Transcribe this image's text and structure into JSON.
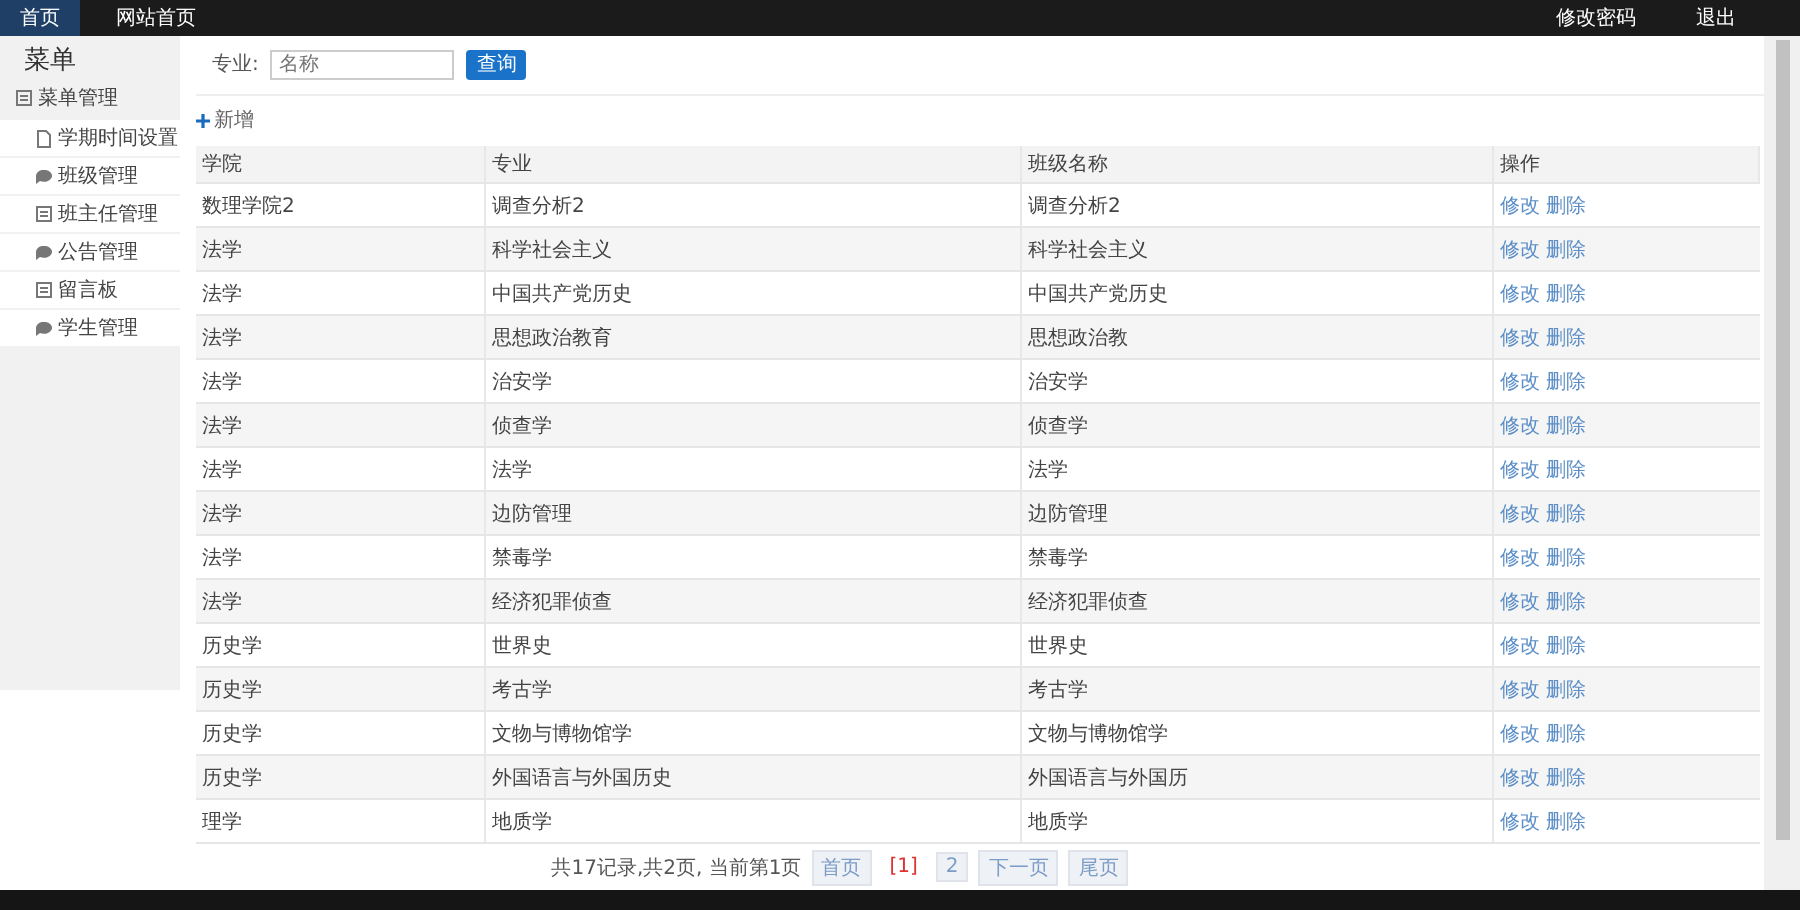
{
  "topnav": {
    "left": [
      {
        "label": "首页",
        "selected": true
      },
      {
        "label": "网站首页",
        "selected": false
      }
    ],
    "right": [
      {
        "label": "修改密码"
      },
      {
        "label": "退出"
      }
    ]
  },
  "sidebar": {
    "title": "菜单",
    "group": "菜单管理",
    "items": [
      {
        "label": "学期时间设置",
        "kind": "page"
      },
      {
        "label": "班级管理",
        "kind": "chat"
      },
      {
        "label": "班主任管理",
        "kind": "list"
      },
      {
        "label": "公告管理",
        "kind": "chat"
      },
      {
        "label": "留言板",
        "kind": "list"
      },
      {
        "label": "学生管理",
        "kind": "chat"
      }
    ]
  },
  "search": {
    "label": "专业:",
    "placeholder": "名称",
    "button": "查询"
  },
  "add_button": "新增",
  "table": {
    "columns": [
      "学院",
      "专业",
      "班级名称",
      "操作"
    ],
    "rows": [
      {
        "cells": [
          "数理学院2",
          "调查分析2",
          "调查分析2"
        ],
        "actions": [
          "修改",
          "删除"
        ]
      },
      {
        "cells": [
          "法学",
          "科学社会主义",
          "科学社会主义"
        ],
        "actions": [
          "修改",
          "删除"
        ]
      },
      {
        "cells": [
          "法学",
          "中国共产党历史",
          "中国共产党历史"
        ],
        "actions": [
          "修改",
          "删除"
        ]
      },
      {
        "cells": [
          "法学",
          "思想政治教育",
          "思想政治教"
        ],
        "actions": [
          "修改",
          "删除"
        ]
      },
      {
        "cells": [
          "法学",
          "治安学",
          "治安学"
        ],
        "actions": [
          "修改",
          "删除"
        ]
      },
      {
        "cells": [
          "法学",
          "侦查学",
          "侦查学"
        ],
        "actions": [
          "修改",
          "删除"
        ]
      },
      {
        "cells": [
          "法学",
          "法学",
          "法学"
        ],
        "actions": [
          "修改",
          "删除"
        ]
      },
      {
        "cells": [
          "法学",
          "边防管理",
          "边防管理"
        ],
        "actions": [
          "修改",
          "删除"
        ]
      },
      {
        "cells": [
          "法学",
          "禁毒学",
          "禁毒学"
        ],
        "actions": [
          "修改",
          "删除"
        ]
      },
      {
        "cells": [
          "法学",
          "经济犯罪侦查",
          "经济犯罪侦查"
        ],
        "actions": [
          "修改",
          "删除"
        ]
      },
      {
        "cells": [
          "历史学",
          "世界史",
          "世界史"
        ],
        "actions": [
          "修改",
          "删除"
        ]
      },
      {
        "cells": [
          "历史学",
          "考古学",
          "考古学"
        ],
        "actions": [
          "修改",
          "删除"
        ]
      },
      {
        "cells": [
          "历史学",
          "文物与博物馆学",
          "文物与博物馆学"
        ],
        "actions": [
          "修改",
          "删除"
        ]
      },
      {
        "cells": [
          "历史学",
          "外国语言与外国历史",
          "外国语言与外国历"
        ],
        "actions": [
          "修改",
          "删除"
        ]
      },
      {
        "cells": [
          "理学",
          "地质学",
          "地质学"
        ],
        "actions": [
          "修改",
          "删除"
        ]
      }
    ]
  },
  "pagination": {
    "summary": "共17记录,共2页, 当前第1页",
    "pages": [
      {
        "label": "首页",
        "selected": false
      },
      {
        "label": "[1]",
        "selected": true
      },
      {
        "label": "2",
        "selected": false
      },
      {
        "label": "下一页",
        "selected": false
      },
      {
        "label": "尾页",
        "selected": false
      }
    ]
  }
}
